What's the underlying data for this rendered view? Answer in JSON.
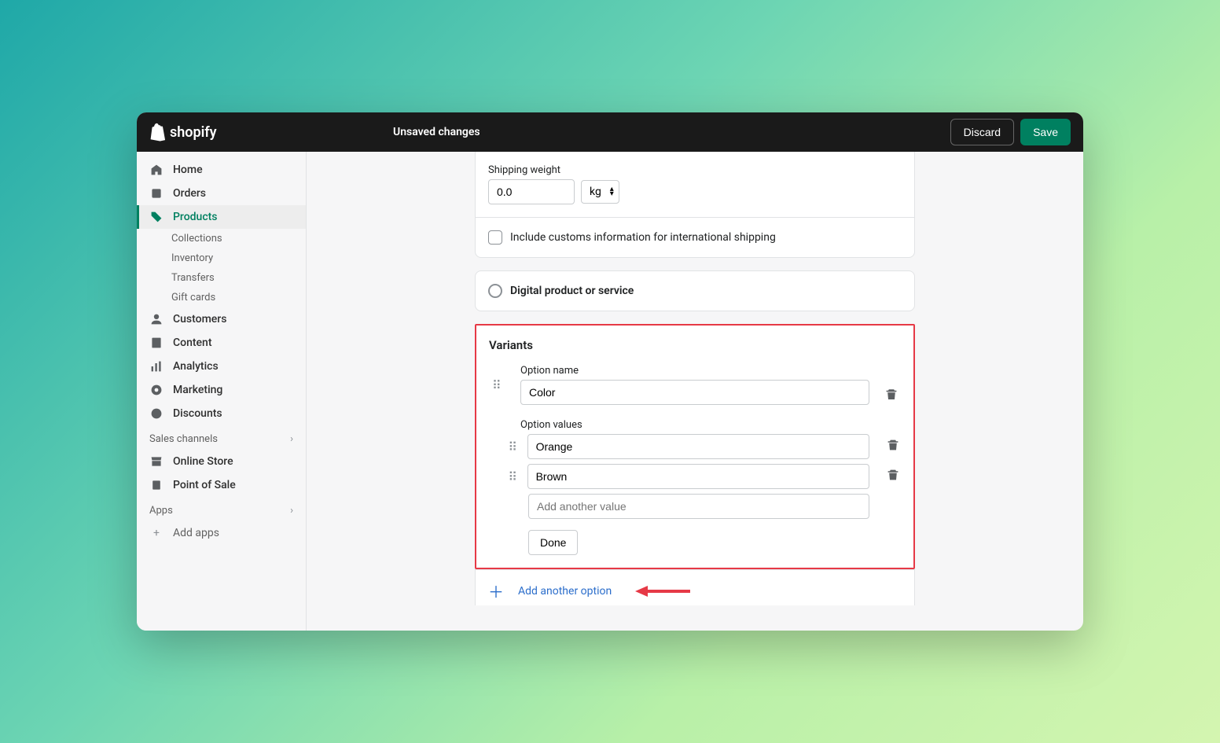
{
  "brand": "shopify",
  "header": {
    "unsaved_label": "Unsaved changes",
    "discard_label": "Discard",
    "save_label": "Save"
  },
  "sidebar": {
    "items": [
      {
        "icon": "home-icon",
        "label": "Home"
      },
      {
        "icon": "orders-icon",
        "label": "Orders"
      },
      {
        "icon": "products-icon",
        "label": "Products",
        "active": true
      },
      {
        "icon": "customers-icon",
        "label": "Customers"
      },
      {
        "icon": "content-icon",
        "label": "Content"
      },
      {
        "icon": "analytics-icon",
        "label": "Analytics"
      },
      {
        "icon": "marketing-icon",
        "label": "Marketing"
      },
      {
        "icon": "discounts-icon",
        "label": "Discounts"
      }
    ],
    "subitems": [
      "Collections",
      "Inventory",
      "Transfers",
      "Gift cards"
    ],
    "sales_channels_label": "Sales channels",
    "channels": [
      {
        "icon": "store-icon",
        "label": "Online Store"
      },
      {
        "icon": "pos-icon",
        "label": "Point of Sale"
      }
    ],
    "apps_label": "Apps",
    "add_apps_label": "Add apps"
  },
  "shipping": {
    "weight_label": "Shipping weight",
    "weight_value": "0.0",
    "weight_unit": "kg",
    "customs_label": "Include customs information for international shipping"
  },
  "digital": {
    "label": "Digital product or service"
  },
  "variants": {
    "title": "Variants",
    "option_name_label": "Option name",
    "option_name_value": "Color",
    "option_values_label": "Option values",
    "values": [
      "Orange",
      "Brown"
    ],
    "add_value_placeholder": "Add another value",
    "done_label": "Done",
    "add_option_label": "Add another option"
  }
}
